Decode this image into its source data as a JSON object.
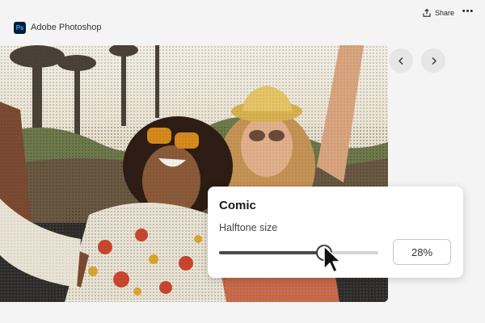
{
  "app": {
    "name": "Adobe Photoshop",
    "logo_text": "Ps",
    "logo_bg": "#001e36",
    "logo_fg": "#31a8ff"
  },
  "header": {
    "share_label": "Share",
    "share_icon": "share-icon",
    "more_label": "•••",
    "more_icon": "more-icon"
  },
  "navigation": {
    "prev_icon": "chevron-left-icon",
    "next_icon": "chevron-right-icon"
  },
  "photo": {
    "effect": "halftone comic"
  },
  "effect_panel": {
    "title": "Comic",
    "control_label": "Halftone size",
    "value_text": "28%",
    "slider_level": 0.66
  }
}
